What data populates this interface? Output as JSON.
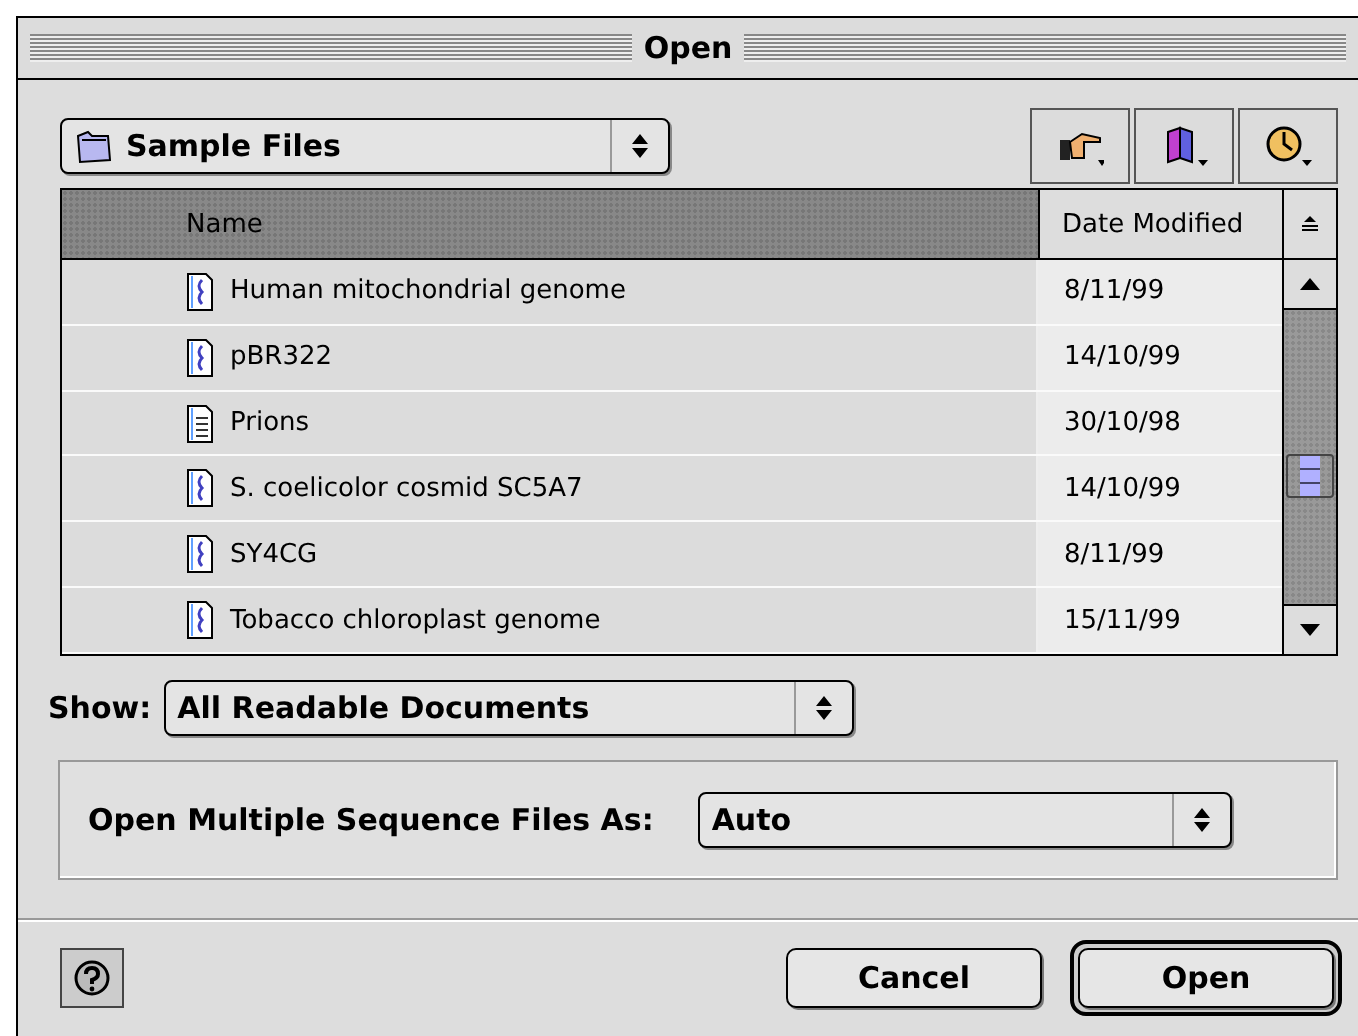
{
  "window": {
    "title": "Open"
  },
  "location": {
    "value": "Sample Files"
  },
  "columns": [
    {
      "label": "Name",
      "selected": true
    },
    {
      "label": "Date Modified",
      "selected": false
    }
  ],
  "rows": [
    {
      "name": "Human mitochondrial genome",
      "date": "8/11/99",
      "kind": "sequence"
    },
    {
      "name": "pBR322",
      "date": "14/10/99",
      "kind": "sequence"
    },
    {
      "name": "Prions",
      "date": "30/10/98",
      "kind": "text"
    },
    {
      "name": "S. coelicolor cosmid SC5A7",
      "date": "14/10/99",
      "kind": "sequence"
    },
    {
      "name": "SY4CG",
      "date": "8/11/99",
      "kind": "sequence"
    },
    {
      "name": "Tobacco chloroplast genome",
      "date": "15/11/99",
      "kind": "sequence"
    }
  ],
  "show": {
    "label": "Show:",
    "value": "All Readable Documents"
  },
  "multiple": {
    "label": "Open Multiple Sequence Files As:",
    "value": "Auto"
  },
  "buttons": [
    {
      "label": "Cancel",
      "kind": "normal"
    },
    {
      "label": "Open",
      "kind": "default"
    }
  ]
}
